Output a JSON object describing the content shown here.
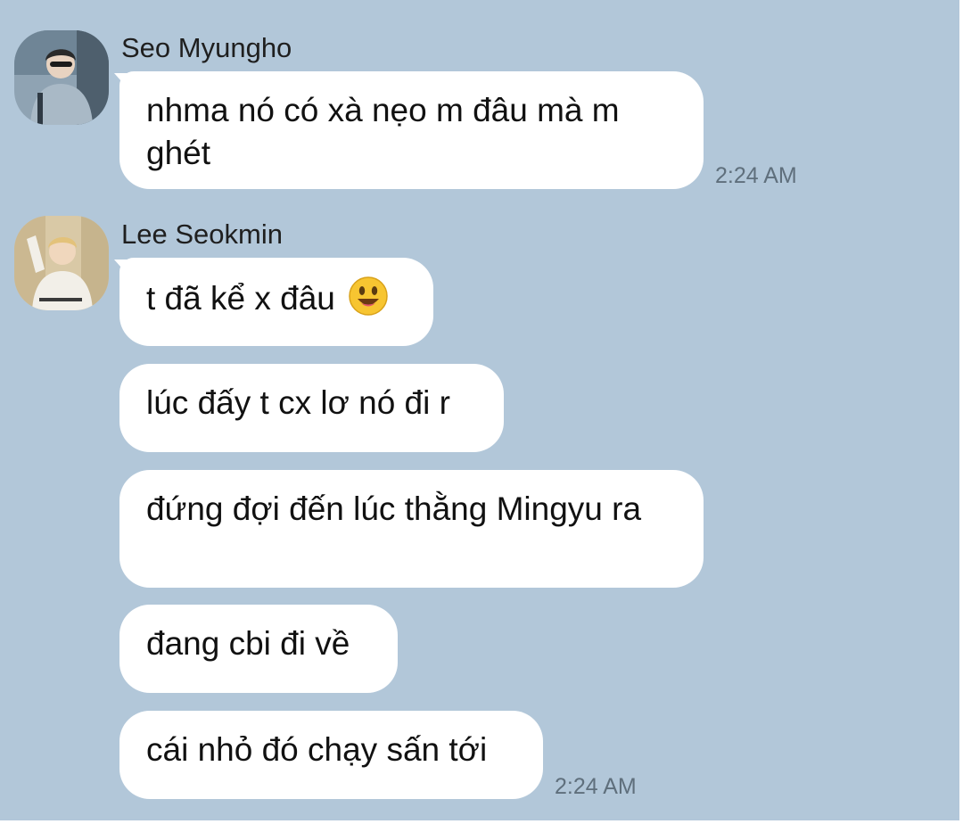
{
  "chat": {
    "groups": [
      {
        "sender": "Seo Myungho",
        "avatar_icon": "profile-photo-icon",
        "messages": [
          {
            "text": "nhma nó có xà nẹo m đâu mà m ghét"
          }
        ],
        "timestamp": "2:24 AM"
      },
      {
        "sender": "Lee Seokmin",
        "avatar_icon": "profile-photo-icon",
        "messages": [
          {
            "text": "t đã kể x đâu",
            "emoji": "smiling-face-emoji"
          },
          {
            "text": "lúc đấy t cx lơ nó đi r"
          },
          {
            "text": "đứng đợi đến lúc thằng Mingyu ra"
          },
          {
            "text": "đang cbi đi về"
          },
          {
            "text": "cái nhỏ đó chạy sấn tới"
          }
        ],
        "timestamp": "2:24 AM"
      }
    ]
  },
  "colors": {
    "background": "#b2c7d9",
    "bubble": "#ffffff",
    "text": "#111111",
    "timestamp": "#5f6f7c"
  }
}
